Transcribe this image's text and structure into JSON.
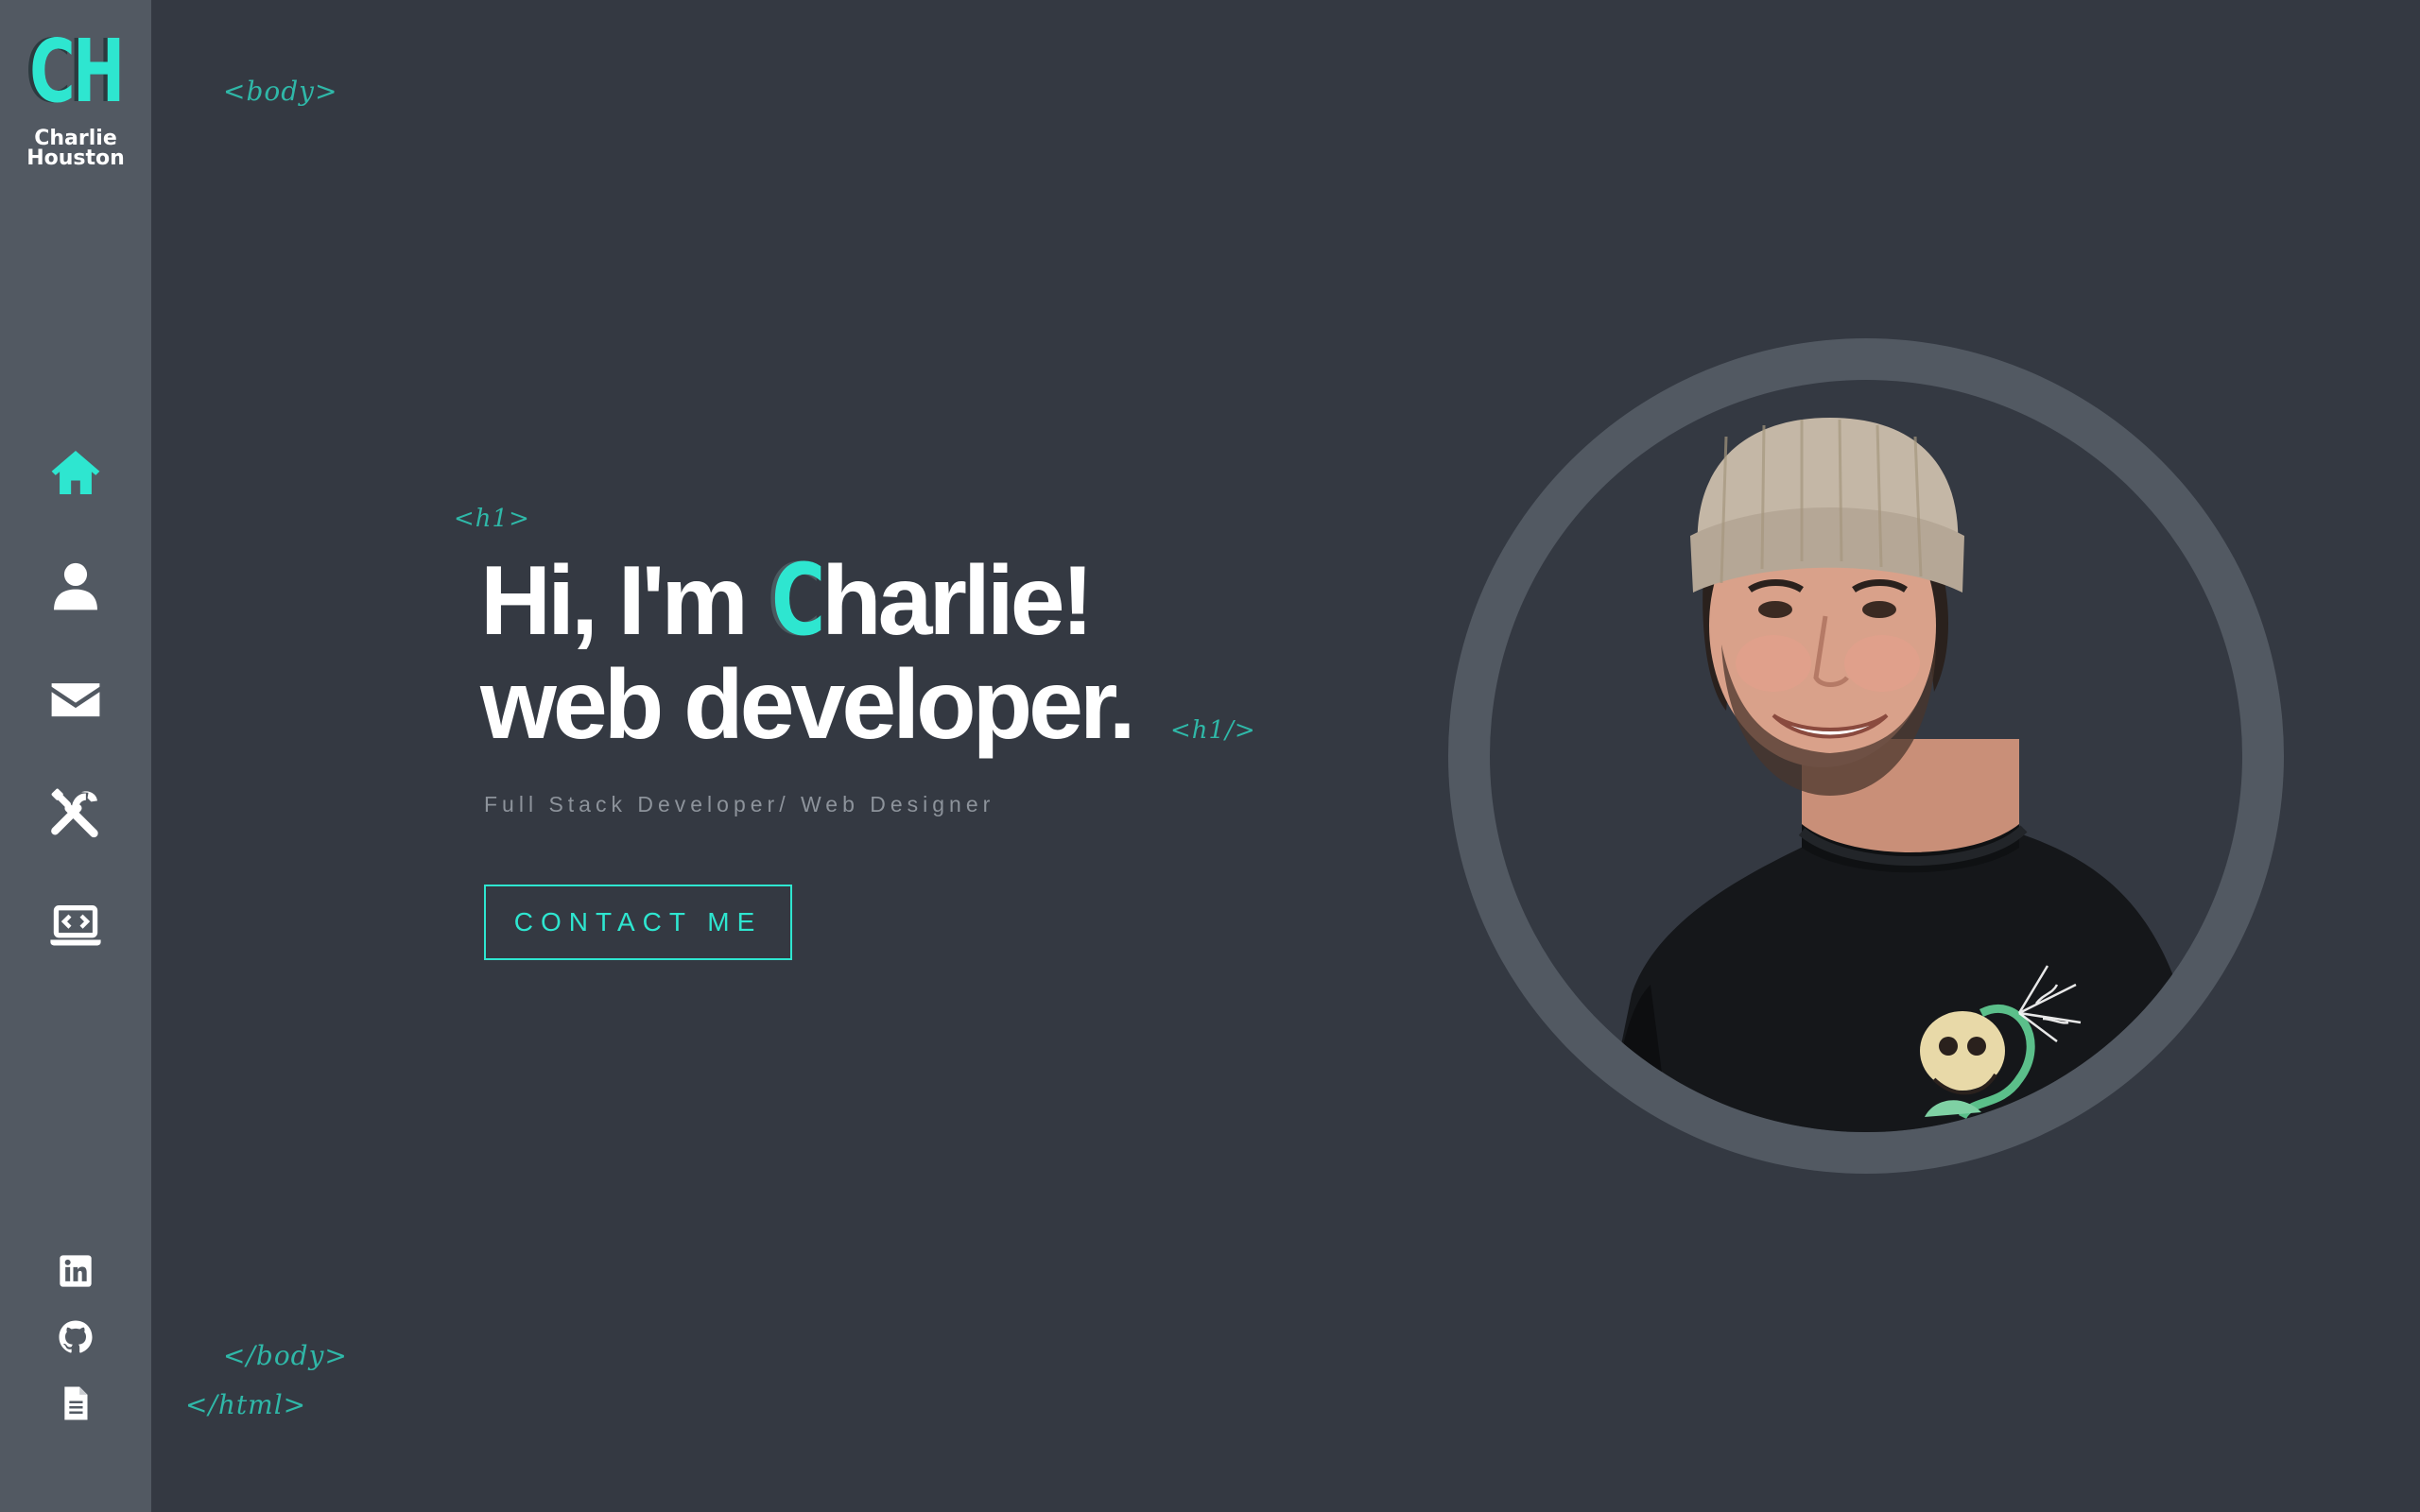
{
  "brand": {
    "monogram": "CH",
    "name_line1": "Charlie",
    "name_line2": "Houston"
  },
  "nav": [
    {
      "id": "home",
      "icon": "home-icon",
      "active": true
    },
    {
      "id": "about",
      "icon": "user-icon",
      "active": false
    },
    {
      "id": "contact",
      "icon": "envelope-icon",
      "active": false
    },
    {
      "id": "skills",
      "icon": "tools-icon",
      "active": false
    },
    {
      "id": "projects",
      "icon": "laptop-code-icon",
      "active": false
    }
  ],
  "social": [
    {
      "id": "linkedin",
      "icon": "linkedin-icon"
    },
    {
      "id": "github",
      "icon": "github-icon"
    },
    {
      "id": "resume",
      "icon": "file-icon"
    }
  ],
  "tags": {
    "body_open": "<body>",
    "h1_open": "<h1>",
    "h1_close": "<h1/>",
    "body_close": "</body>",
    "html_close": "</html>"
  },
  "hero": {
    "greeting_prefix": "Hi, I'm ",
    "greeting_initial": "C",
    "greeting_rest": "harlie!",
    "line2": "web developer.",
    "subtitle": "Full Stack Developer/ Web Designer",
    "cta_label": "CONTACT ME"
  },
  "colors": {
    "background": "#343942",
    "sidebar": "#525962",
    "accent": "#2ee6d0",
    "tag": "#2fb8a8",
    "text": "#ffffff",
    "muted": "#8d939b"
  }
}
